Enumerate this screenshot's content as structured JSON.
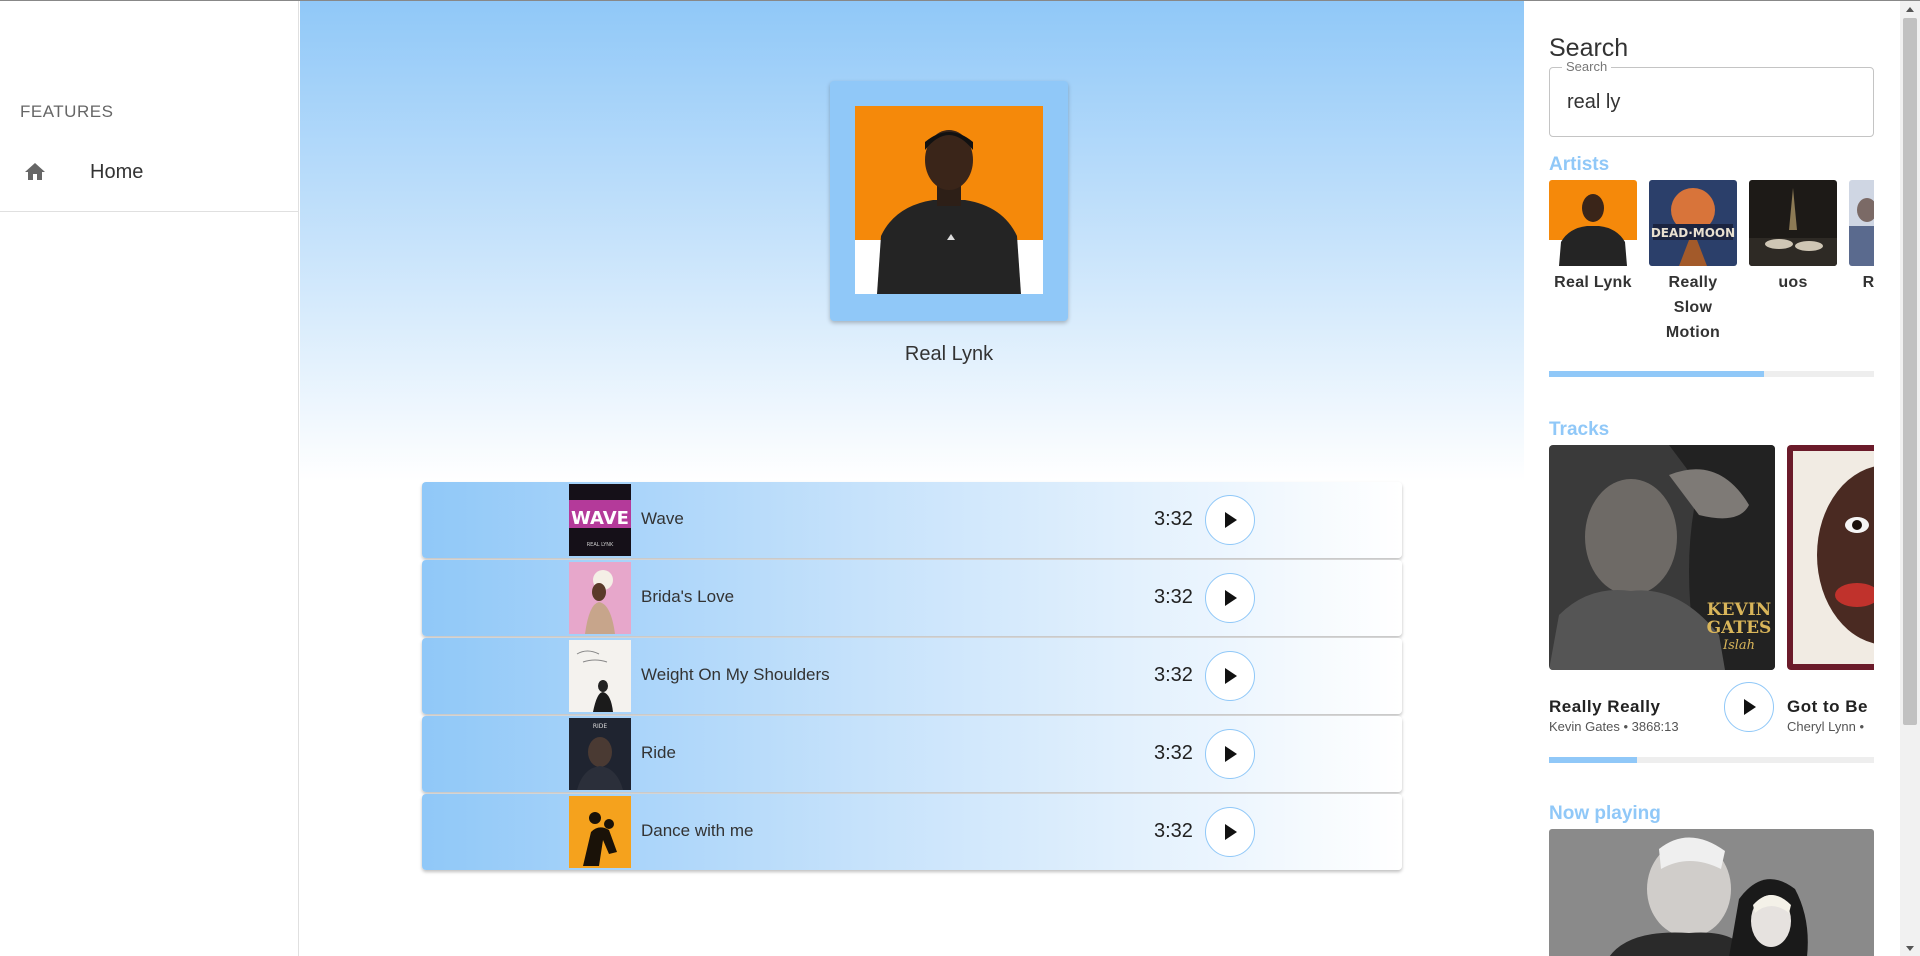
{
  "sidebar": {
    "section_label": "FEATURES",
    "items": [
      {
        "label": "Home",
        "icon": "home-icon"
      }
    ]
  },
  "artist": {
    "name": "Real Lynk"
  },
  "tracks": [
    {
      "title": "Wave",
      "duration": "3:32"
    },
    {
      "title": "Brida's Love",
      "duration": "3:32"
    },
    {
      "title": "Weight On My Shoulders",
      "duration": "3:32"
    },
    {
      "title": "Ride",
      "duration": "3:32"
    },
    {
      "title": "Dance with me",
      "duration": "3:32"
    }
  ],
  "search": {
    "title": "Search",
    "field_label": "Search",
    "value": "real ly"
  },
  "results": {
    "artists_title": "Artists",
    "artists": [
      {
        "name": "Real Lynk"
      },
      {
        "name": "Really Slow Motion"
      },
      {
        "name": "uos"
      },
      {
        "name": "Real Re"
      }
    ],
    "artists_scroll_progress": 0.66,
    "tracks_title": "Tracks",
    "tracks": [
      {
        "title": "Really Really",
        "artist": "Kevin Gates",
        "duration": "3868:13"
      },
      {
        "title": "Got to Be",
        "artist": "Cheryl Lynn",
        "duration": ""
      }
    ],
    "tracks_scroll_progress": 0.27,
    "now_playing_title": "Now playing"
  },
  "colors": {
    "accent": "#90c8f8",
    "orange": "#f5890a"
  }
}
